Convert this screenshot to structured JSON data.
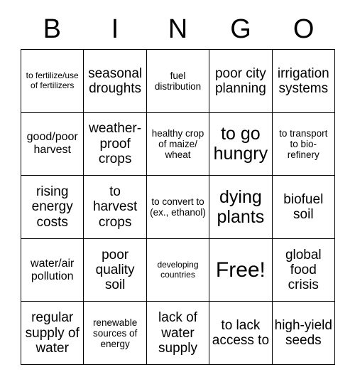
{
  "card": {
    "title": "BINGO",
    "header_letters": [
      "B",
      "I",
      "N",
      "G",
      "O"
    ],
    "free_space_label": "Free!",
    "colors": {
      "background": "#ffffff",
      "text": "#000000",
      "grid_line": "#000000"
    },
    "grid_size": "5x5",
    "cells": [
      {
        "text": "to fertilize/use of fertilizers",
        "size": "xs",
        "column": "B",
        "row": 1
      },
      {
        "text": "seasonal droughts",
        "size": "lg",
        "column": "I",
        "row": 1
      },
      {
        "text": "fuel distribution",
        "size": "sm",
        "column": "N",
        "row": 1
      },
      {
        "text": "poor city planning",
        "size": "lg",
        "column": "G",
        "row": 1
      },
      {
        "text": "irrigation systems",
        "size": "lg",
        "column": "O",
        "row": 1
      },
      {
        "text": "good/poor harvest",
        "size": "md",
        "column": "B",
        "row": 2
      },
      {
        "text": "weather-proof crops",
        "size": "lg",
        "column": "I",
        "row": 2
      },
      {
        "text": "healthy crop of maize/ wheat",
        "size": "sm",
        "column": "N",
        "row": 2
      },
      {
        "text": "to go hungry",
        "size": "xl",
        "column": "G",
        "row": 2
      },
      {
        "text": "to transport to bio-refinery",
        "size": "sm",
        "column": "O",
        "row": 2
      },
      {
        "text": "rising energy costs",
        "size": "lg",
        "column": "B",
        "row": 3
      },
      {
        "text": "to harvest crops",
        "size": "lg",
        "column": "I",
        "row": 3
      },
      {
        "text": "to convert to (ex., ethanol)",
        "size": "sm",
        "column": "N",
        "row": 3
      },
      {
        "text": "dying plants",
        "size": "xl",
        "column": "G",
        "row": 3
      },
      {
        "text": "biofuel soil",
        "size": "lg",
        "column": "O",
        "row": 3
      },
      {
        "text": "water/air pollution",
        "size": "md",
        "column": "B",
        "row": 4
      },
      {
        "text": "poor quality soil",
        "size": "lg",
        "column": "I",
        "row": 4
      },
      {
        "text": "developing countries",
        "size": "xs",
        "column": "N",
        "row": 4
      },
      {
        "text": "Free!",
        "size": "xxl",
        "column": "G",
        "row": 4
      },
      {
        "text": "global food crisis",
        "size": "lg",
        "column": "O",
        "row": 4
      },
      {
        "text": "regular supply of water",
        "size": "lg",
        "column": "B",
        "row": 5
      },
      {
        "text": "renewable sources of energy",
        "size": "sm",
        "column": "I",
        "row": 5
      },
      {
        "text": "lack of water supply",
        "size": "lg",
        "column": "N",
        "row": 5
      },
      {
        "text": "to lack access to",
        "size": "lg",
        "column": "G",
        "row": 5
      },
      {
        "text": "high-yield seeds",
        "size": "lg",
        "column": "O",
        "row": 5
      }
    ]
  }
}
